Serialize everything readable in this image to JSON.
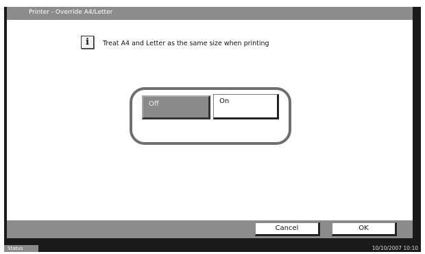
{
  "header": {
    "title": "Printer - Override A4/Letter"
  },
  "info": {
    "icon": "info-icon",
    "icon_glyph": "i",
    "message": "Treat A4 and Letter as the same size when printing"
  },
  "toggle": {
    "options": [
      {
        "label": "Off"
      },
      {
        "label": "On"
      }
    ]
  },
  "footer": {
    "cancel_label": "Cancel",
    "ok_label": "OK"
  },
  "status_bar": {
    "status_label": "Status",
    "datetime": "10/10/2007   10:10"
  },
  "colors": {
    "title_bar": "#8c8c8c",
    "selected_button": "#8a8a8a",
    "frame": "#6f6f6f",
    "screen_bg": "#1a1a1a"
  }
}
